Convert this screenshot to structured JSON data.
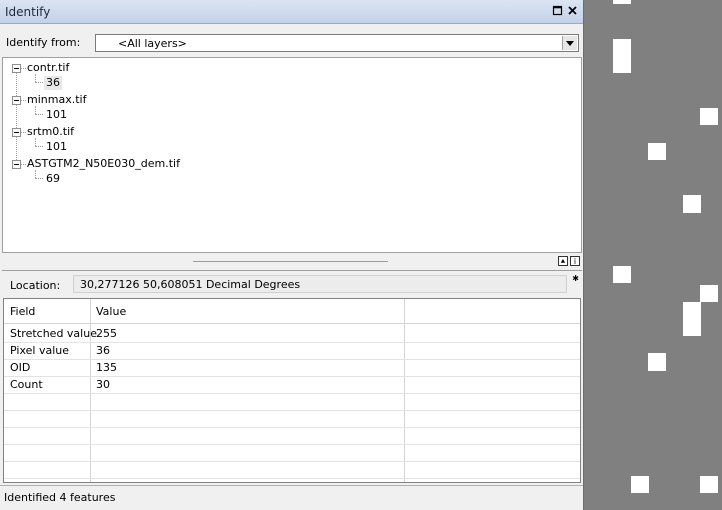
{
  "window": {
    "title": "Identify"
  },
  "identify_from": {
    "label": "Identify from:",
    "selected": "<All layers>"
  },
  "tree": [
    {
      "layer": "contr.tif",
      "value": "36"
    },
    {
      "layer": "minmax.tif",
      "value": "101"
    },
    {
      "layer": "srtm0.tif",
      "value": "101"
    },
    {
      "layer": "ASTGTM2_N50E030_dem.tif",
      "value": "69"
    }
  ],
  "location": {
    "label": "Location:",
    "value": "30,277126  50,608051 Decimal Degrees"
  },
  "table": {
    "columns": [
      "Field",
      "Value"
    ],
    "rows": [
      {
        "field": "Stretched value",
        "value": "255"
      },
      {
        "field": "Pixel value",
        "value": "36"
      },
      {
        "field": "OID",
        "value": "135"
      },
      {
        "field": "Count",
        "value": "30"
      }
    ]
  },
  "status": {
    "text": "Identified 4 features"
  },
  "icons": {
    "restore": "restore-window-icon",
    "close": "close-icon",
    "dropdown": "chevron-down-icon",
    "collapse": "collapse-tree-icon",
    "info": "layer-info-icon"
  },
  "colors": {
    "map_background": "#808080",
    "map_pixels": "#ffffff",
    "title_bar": "#c3d2e9"
  }
}
